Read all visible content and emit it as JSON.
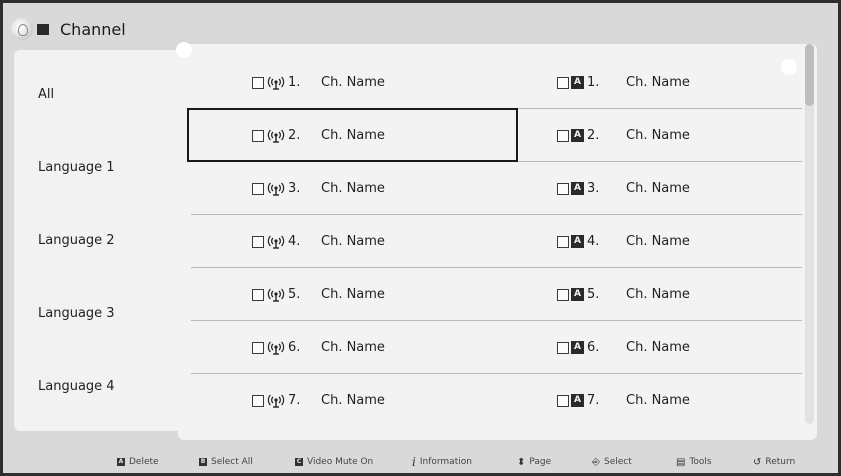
{
  "header": {
    "title": "Channel",
    "logo_icon": "smart-hub-icon"
  },
  "categories": [
    {
      "label": "All"
    },
    {
      "label": "Language 1"
    },
    {
      "label": "Language 2"
    },
    {
      "label": "Language 3"
    },
    {
      "label": "Language 4"
    }
  ],
  "channels": [
    {
      "left": {
        "num": "1.",
        "name": "Ch. Name"
      },
      "right": {
        "num": "1.",
        "name": "Ch. Name"
      }
    },
    {
      "left": {
        "num": "2.",
        "name": "Ch. Name"
      },
      "right": {
        "num": "2.",
        "name": "Ch. Name"
      }
    },
    {
      "left": {
        "num": "3.",
        "name": "Ch. Name"
      },
      "right": {
        "num": "3.",
        "name": "Ch. Name"
      }
    },
    {
      "left": {
        "num": "4.",
        "name": "Ch. Name"
      },
      "right": {
        "num": "4.",
        "name": "Ch. Name"
      }
    },
    {
      "left": {
        "num": "5.",
        "name": "Ch. Name"
      },
      "right": {
        "num": "5.",
        "name": "Ch. Name"
      }
    },
    {
      "left": {
        "num": "6.",
        "name": "Ch. Name"
      },
      "right": {
        "num": "6.",
        "name": "Ch. Name"
      }
    },
    {
      "left": {
        "num": "7.",
        "name": "Ch. Name"
      },
      "right": {
        "num": "7.",
        "name": "Ch. Name"
      }
    }
  ],
  "channel_icons": {
    "left": "antenna-icon",
    "right": "analog-a-icon",
    "a_letter": "A"
  },
  "footer": {
    "delete": "Delete",
    "select_all": "Select All",
    "video_mute": "Video Mute On",
    "information": "Information",
    "page": "Page",
    "select": "Select",
    "tools": "Tools",
    "return": "Return",
    "key_a": "A",
    "key_b": "B",
    "key_c": "C",
    "info_glyph": "i"
  },
  "colors": {
    "background": "#d9d9d9",
    "panel": "#f3f3f3",
    "focus_border": "#1a1a1a"
  }
}
